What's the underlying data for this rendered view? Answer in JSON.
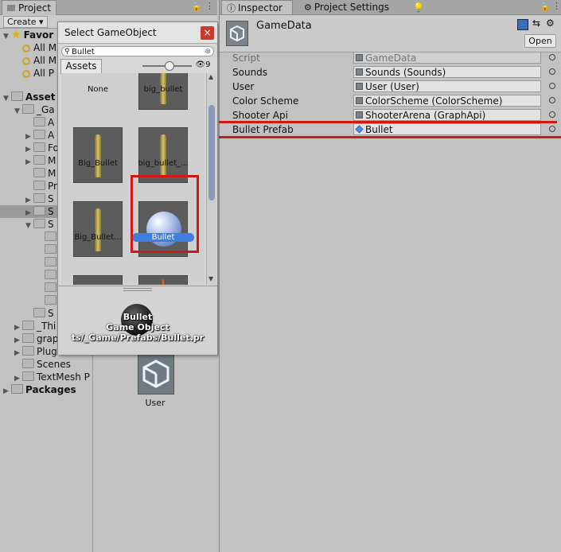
{
  "project": {
    "tab_label": "Project",
    "create_label": "Create",
    "tree": [
      {
        "label": "Favor",
        "kind": "favorites",
        "indent": 0,
        "expanded": true
      },
      {
        "label": "All M",
        "kind": "search",
        "indent": 1
      },
      {
        "label": "All M",
        "kind": "search",
        "indent": 1
      },
      {
        "label": "All P",
        "kind": "search",
        "indent": 1
      },
      {
        "label": "Asset",
        "kind": "folder-bold",
        "indent": 0,
        "expanded": true
      },
      {
        "label": "_Ga",
        "kind": "folder",
        "indent": 1,
        "expanded": true
      },
      {
        "label": "A",
        "kind": "folder",
        "indent": 2
      },
      {
        "label": "A",
        "kind": "folder",
        "indent": 2,
        "collapsed": true
      },
      {
        "label": "Fo",
        "kind": "folder",
        "indent": 2,
        "collapsed": true
      },
      {
        "label": "M",
        "kind": "folder",
        "indent": 2,
        "collapsed": true
      },
      {
        "label": "M",
        "kind": "folder",
        "indent": 2
      },
      {
        "label": "Pr",
        "kind": "folder",
        "indent": 2
      },
      {
        "label": "S",
        "kind": "folder",
        "indent": 2,
        "collapsed": true
      },
      {
        "label": "S",
        "kind": "folder",
        "indent": 2,
        "collapsed": true,
        "selected": true
      },
      {
        "label": "S",
        "kind": "folder",
        "indent": 2,
        "expanded": true
      },
      {
        "label": "",
        "kind": "folder",
        "indent": 3
      },
      {
        "label": "",
        "kind": "folder",
        "indent": 3
      },
      {
        "label": "",
        "kind": "folder",
        "indent": 3
      },
      {
        "label": "",
        "kind": "folder",
        "indent": 3
      },
      {
        "label": "",
        "kind": "folder",
        "indent": 3
      },
      {
        "label": "",
        "kind": "folder",
        "indent": 3
      },
      {
        "label": "S",
        "kind": "folder",
        "indent": 2
      },
      {
        "label": "_Thi",
        "kind": "folder",
        "indent": 1,
        "collapsed": true
      },
      {
        "label": "grap",
        "kind": "folder",
        "indent": 1,
        "collapsed": true
      },
      {
        "label": "Plug",
        "kind": "folder",
        "indent": 1,
        "collapsed": true
      },
      {
        "label": "Scenes",
        "kind": "folder",
        "indent": 1
      },
      {
        "label": "TextMesh P",
        "kind": "folder",
        "indent": 1,
        "collapsed": true
      },
      {
        "label": "Packages",
        "kind": "folder-bold",
        "indent": 0,
        "collapsed": true
      }
    ],
    "user_asset_label": "User"
  },
  "popup": {
    "title": "Select GameObject",
    "search_value": "Bullet",
    "tab_label": "Assets",
    "hidden_count": "9",
    "items": [
      {
        "label": "None",
        "kind": "none"
      },
      {
        "label": "big_bullet",
        "kind": "bullet-partial"
      },
      {
        "label": "Big_Bullet",
        "kind": "bullet"
      },
      {
        "label": "big_bullet_...",
        "kind": "bullet"
      },
      {
        "label": "Big_Bullet...",
        "kind": "bullet"
      },
      {
        "label": "Bullet",
        "kind": "sphere",
        "selected": true
      },
      {
        "label": "",
        "kind": "white-blob"
      },
      {
        "label": "",
        "kind": "bullet-tip"
      }
    ],
    "preview": {
      "name": "Bullet",
      "type": "Game Object",
      "path": "ts/_Game/Prefabs/Bullet.pr"
    }
  },
  "inspector": {
    "tabs": [
      {
        "label": "Inspector",
        "icon": "info-icon",
        "active": true
      },
      {
        "label": "Project Settings",
        "icon": "gear-icon"
      },
      {
        "label": "Lighting",
        "icon": "lightbulb-icon"
      }
    ],
    "object_name": "GameData",
    "open_label": "Open",
    "properties": [
      {
        "label": "Script",
        "value": "GameData",
        "disabled": true,
        "icon": "script"
      },
      {
        "label": "Sounds",
        "value": "Sounds (Sounds)",
        "icon": "script"
      },
      {
        "label": "User",
        "value": "User (User)",
        "icon": "script"
      },
      {
        "label": "Color Scheme",
        "value": "ColorScheme (ColorScheme)",
        "icon": "script"
      },
      {
        "label": "Shooter Api",
        "value": "ShooterArena (GraphApi)",
        "icon": "script"
      },
      {
        "label": "Bullet Prefab",
        "value": "Bullet",
        "icon": "cube",
        "highlighted": true
      }
    ]
  },
  "colors": {
    "annotation_red": "#d01818",
    "selection_blue": "#3d7fe0"
  }
}
